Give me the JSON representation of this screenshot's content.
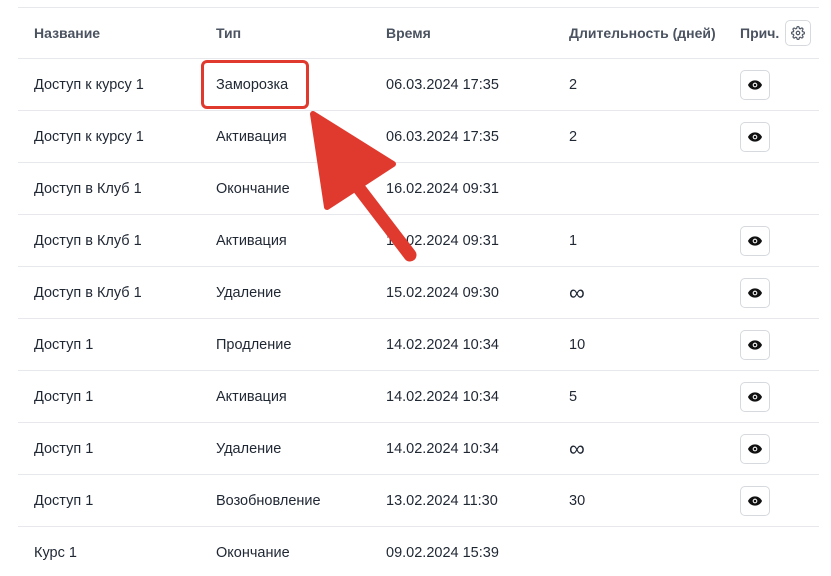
{
  "table": {
    "columns": {
      "name": "Название",
      "type": "Тип",
      "time": "Время",
      "duration": "Длительность (дней)",
      "reason": "Прич."
    },
    "rows": [
      {
        "name": "Доступ к курсу 1",
        "type": "Заморозка",
        "time": "06.03.2024 17:35",
        "duration": "2",
        "has_view": true
      },
      {
        "name": "Доступ к курсу 1",
        "type": "Активация",
        "time": "06.03.2024 17:35",
        "duration": "2",
        "has_view": true
      },
      {
        "name": "Доступ в Клуб 1",
        "type": "Окончание",
        "time": "16.02.2024 09:31",
        "duration": "",
        "has_view": false
      },
      {
        "name": "Доступ в Клуб 1",
        "type": "Активация",
        "time": "16.02.2024 09:31",
        "duration": "1",
        "has_view": true
      },
      {
        "name": "Доступ в Клуб 1",
        "type": "Удаление",
        "time": "15.02.2024 09:30",
        "duration": "∞",
        "has_view": true
      },
      {
        "name": "Доступ 1",
        "type": "Продление",
        "time": "14.02.2024 10:34",
        "duration": "10",
        "has_view": true
      },
      {
        "name": "Доступ 1",
        "type": "Активация",
        "time": "14.02.2024 10:34",
        "duration": "5",
        "has_view": true
      },
      {
        "name": "Доступ 1",
        "type": "Удаление",
        "time": "14.02.2024 10:34",
        "duration": "∞",
        "has_view": true
      },
      {
        "name": "Доступ 1",
        "type": "Возобновление",
        "time": "13.02.2024 11:30",
        "duration": "30",
        "has_view": true
      },
      {
        "name": "Курс 1",
        "type": "Окончание",
        "time": "09.02.2024 15:39",
        "duration": "",
        "has_view": false
      }
    ]
  },
  "icons": {
    "settings": "gear-icon",
    "view": "eye-icon"
  },
  "annotation": {
    "highlight_color": "#e03a2f"
  }
}
